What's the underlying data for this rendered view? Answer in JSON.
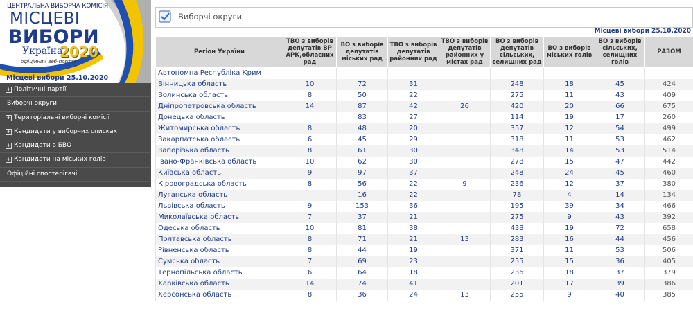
{
  "sidebar": {
    "cvk": "ЦЕНТРАЛЬНА ВИБОРЧА КОМІСІЯ",
    "title1": "МІСЦЕВІ",
    "title2": "ВИБОРИ",
    "country": "Україна",
    "year": "2020",
    "portal": "офіційний веб-портал",
    "date": "Місцеві вибори 25.10.2020",
    "menu": [
      {
        "label": "Політичні партії",
        "expandable": true
      },
      {
        "label": "Виборчі округи",
        "expandable": false
      },
      {
        "label": "Територіальні виборчі комісії",
        "expandable": true
      },
      {
        "label": "Кандидати у виборчих списках",
        "expandable": true
      },
      {
        "label": "Кандидати в БВО",
        "expandable": true
      },
      {
        "label": "Кандидати на міських голів",
        "expandable": true
      },
      {
        "label": "Офіційні спостерігачі",
        "expandable": false
      }
    ],
    "colors": {
      "menu_bg": "#4a4a4a",
      "brand_blue": "#1f3c8a",
      "brand_yellow": "#f0c020"
    }
  },
  "main": {
    "title": "Виборчі округи",
    "icon": "checkbox-icon",
    "edition": "Місцеві вибори 25.10.2020",
    "columns": [
      "Регіон України",
      "ТВО з виборів депутатів ВР АРК,обласних рад",
      "ВО з виборів депутатів міських рад",
      "ТВО з виборів депутатів районних рад",
      "ТВО з виборів депутатів районних у містах рад",
      "ВО з виборів депутатів сільських, селищних рад",
      "ВО з виборів міських голів",
      "ВО з виборів сільських, селищних голів",
      "РАЗОМ"
    ],
    "rows": [
      [
        "Автономна Республіка Крим",
        "",
        "",
        "",
        "",
        "",
        "",
        "",
        ""
      ],
      [
        "Вінницька область",
        "10",
        "72",
        "31",
        "",
        "248",
        "18",
        "45",
        "424"
      ],
      [
        "Волинська область",
        "8",
        "50",
        "22",
        "",
        "275",
        "11",
        "43",
        "409"
      ],
      [
        "Дніпропетровська область",
        "14",
        "87",
        "42",
        "26",
        "420",
        "20",
        "66",
        "675"
      ],
      [
        "Донецька область",
        "",
        "83",
        "27",
        "",
        "114",
        "19",
        "17",
        "260"
      ],
      [
        "Житомирська область",
        "8",
        "48",
        "20",
        "",
        "357",
        "12",
        "54",
        "499"
      ],
      [
        "Закарпатська область",
        "6",
        "45",
        "29",
        "",
        "318",
        "11",
        "53",
        "462"
      ],
      [
        "Запорізька область",
        "8",
        "61",
        "30",
        "",
        "348",
        "14",
        "53",
        "514"
      ],
      [
        "Івано-Франківська область",
        "10",
        "62",
        "30",
        "",
        "278",
        "15",
        "47",
        "442"
      ],
      [
        "Київська область",
        "9",
        "97",
        "37",
        "",
        "248",
        "24",
        "45",
        "460"
      ],
      [
        "Кіровоградська область",
        "8",
        "56",
        "22",
        "9",
        "236",
        "12",
        "37",
        "380"
      ],
      [
        "Луганська область",
        "",
        "16",
        "22",
        "",
        "78",
        "4",
        "14",
        "134"
      ],
      [
        "Львівська область",
        "9",
        "153",
        "36",
        "",
        "195",
        "39",
        "34",
        "466"
      ],
      [
        "Миколаївська область",
        "7",
        "37",
        "21",
        "",
        "275",
        "9",
        "43",
        "392"
      ],
      [
        "Одеська область",
        "10",
        "81",
        "38",
        "",
        "438",
        "19",
        "72",
        "658"
      ],
      [
        "Полтавська область",
        "8",
        "71",
        "21",
        "13",
        "283",
        "16",
        "44",
        "456"
      ],
      [
        "Рівненська область",
        "8",
        "44",
        "19",
        "",
        "371",
        "11",
        "53",
        "506"
      ],
      [
        "Сумська область",
        "7",
        "69",
        "23",
        "",
        "255",
        "15",
        "36",
        "405"
      ],
      [
        "Тернопільська область",
        "6",
        "64",
        "18",
        "",
        "236",
        "18",
        "37",
        "379"
      ],
      [
        "Харківська область",
        "14",
        "74",
        "41",
        "",
        "201",
        "17",
        "39",
        "386"
      ],
      [
        "Херсонська область",
        "8",
        "36",
        "24",
        "13",
        "255",
        "9",
        "40",
        "385"
      ]
    ]
  }
}
